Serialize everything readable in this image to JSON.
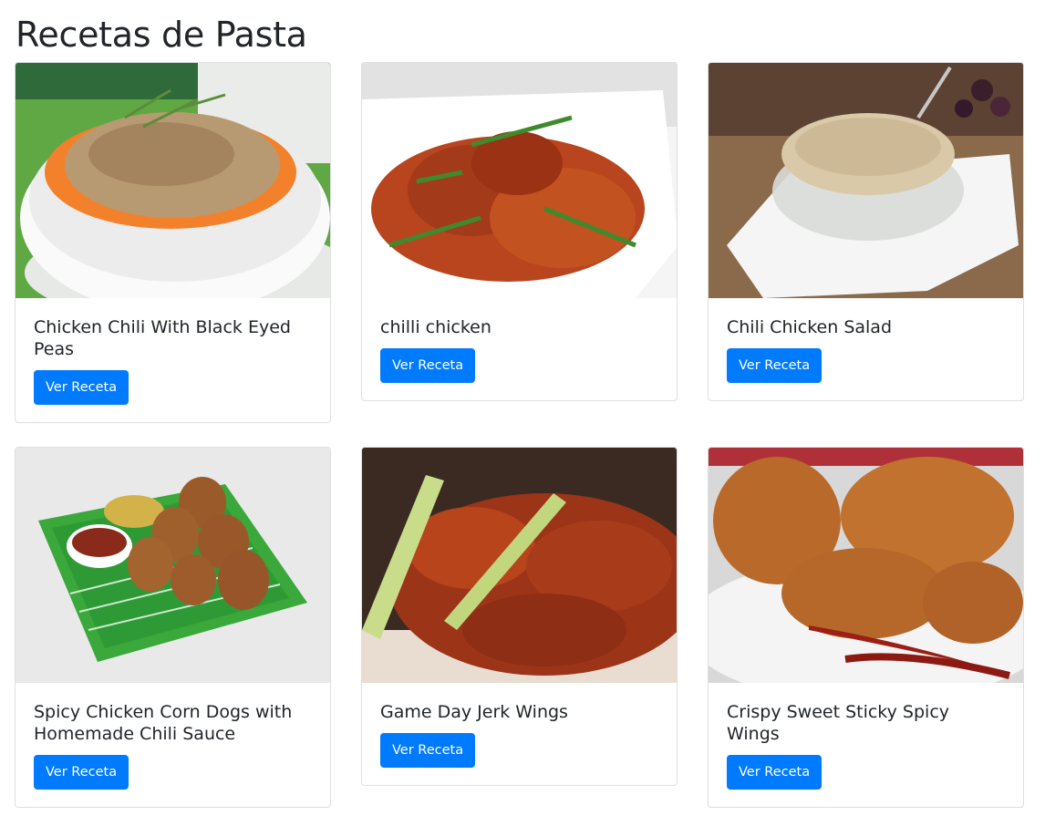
{
  "page_title": "Recetas de Pasta",
  "button_label": "Ver Receta",
  "accent_color": "#007bff",
  "recipes": [
    {
      "title": "Chicken Chili With Black Eyed Peas",
      "image": "bowl-of-chili-with-black-eyed-peas"
    },
    {
      "title": "chilli chicken",
      "image": "plate-of-chilli-chicken"
    },
    {
      "title": "Chili Chicken Salad",
      "image": "glass-bowl-of-chicken-salad"
    },
    {
      "title": "Spicy Chicken Corn Dogs with Homemade Chili Sauce",
      "image": "corn-dogs-on-football-tray"
    },
    {
      "title": "Game Day Jerk Wings",
      "image": "jerk-wings-with-celery"
    },
    {
      "title": "Crispy Sweet Sticky Spicy Wings",
      "image": "sticky-wings-with-chili"
    }
  ]
}
